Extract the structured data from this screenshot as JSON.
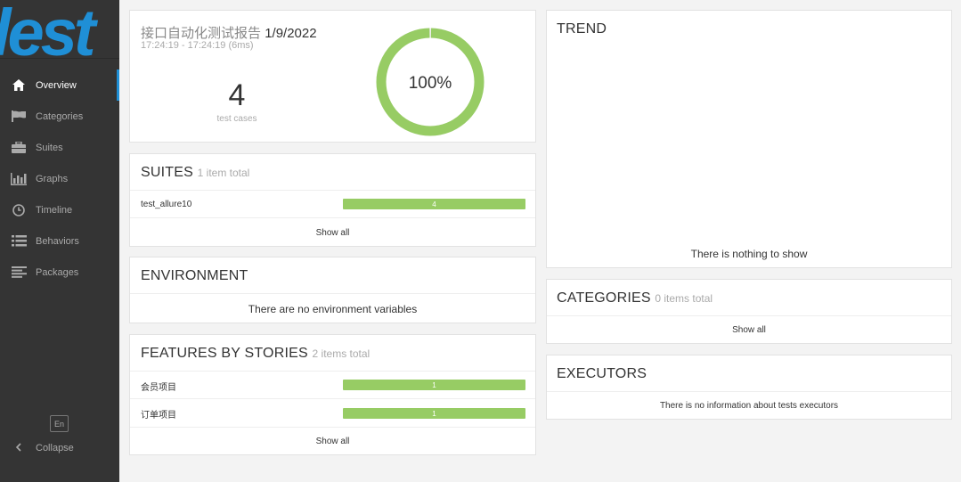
{
  "sidebar": {
    "logo": "lest",
    "items": [
      {
        "label": "Overview",
        "icon": "home-icon",
        "active": true
      },
      {
        "label": "Categories",
        "icon": "flag-icon"
      },
      {
        "label": "Suites",
        "icon": "briefcase-icon"
      },
      {
        "label": "Graphs",
        "icon": "bar-chart-icon"
      },
      {
        "label": "Timeline",
        "icon": "clock-icon"
      },
      {
        "label": "Behaviors",
        "icon": "list-icon"
      },
      {
        "label": "Packages",
        "icon": "align-left-icon"
      }
    ],
    "language": "En",
    "collapse_label": "Collapse"
  },
  "summary": {
    "title": "接口自动化测试报告",
    "date": "1/9/2022",
    "time_range": "17:24:19 - 17:24:19 (6ms)",
    "test_count": "4",
    "test_count_label": "test cases",
    "pass_rate": "100%",
    "pass_fraction": 1.0
  },
  "suites": {
    "title": "SUITES",
    "total": "1 item total",
    "rows": [
      {
        "name": "test_allure10",
        "count": "4"
      }
    ],
    "show_all": "Show all"
  },
  "environment": {
    "title": "ENVIRONMENT",
    "message": "There are no environment variables"
  },
  "features": {
    "title": "FEATURES BY STORIES",
    "total": "2 items total",
    "rows": [
      {
        "name": "会员项目",
        "count": "1"
      },
      {
        "name": "订单项目",
        "count": "1"
      }
    ],
    "show_all": "Show all"
  },
  "trend": {
    "title": "TREND",
    "message": "There is nothing to show"
  },
  "categories": {
    "title": "CATEGORIES",
    "total": "0 items total",
    "show_all": "Show all"
  },
  "executors": {
    "title": "EXECUTORS",
    "message": "There is no information about tests executors"
  },
  "colors": {
    "sidebar_bg": "#343434",
    "accent": "#1f8fd6",
    "passed": "#97cc64"
  }
}
